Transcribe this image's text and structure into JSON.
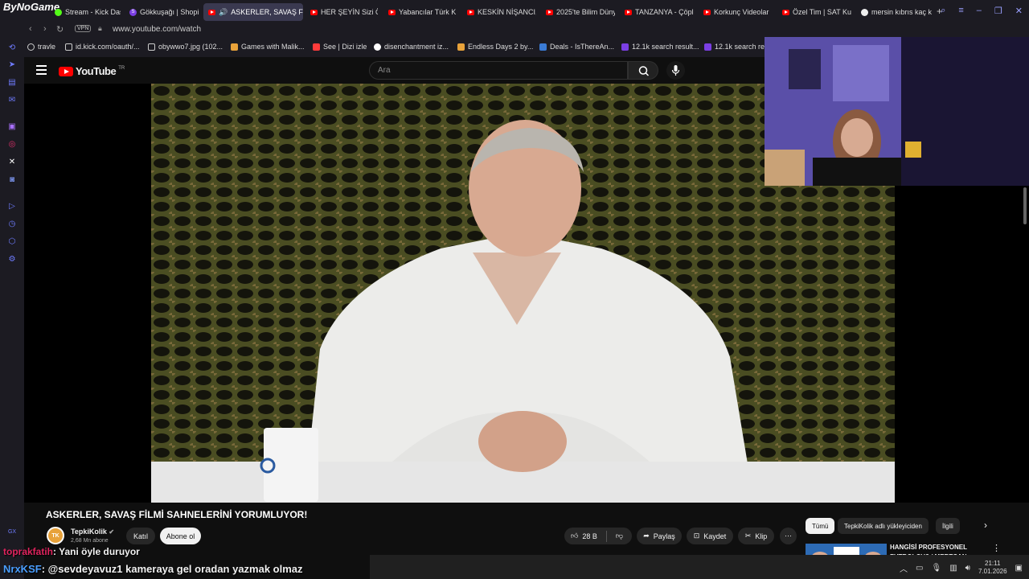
{
  "browser": {
    "logo_text": "ByNoGame",
    "tabs": [
      {
        "label": "Stream - Kick Dash",
        "icon": "kick-icon"
      },
      {
        "label": "Gökkuşağı | Shopi",
        "icon": "shop-icon"
      },
      {
        "label": "ASKERLER, SAVAŞ Fİ",
        "icon": "youtube-icon"
      },
      {
        "label": "HER ŞEYİN Sizi Ö",
        "icon": "youtube-icon"
      },
      {
        "label": "Yabancılar Türk K",
        "icon": "youtube-icon"
      },
      {
        "label": "KESKİN NİŞANCI,",
        "icon": "youtube-icon"
      },
      {
        "label": "2025'te Bilim Düny",
        "icon": "youtube-icon"
      },
      {
        "label": "TANZANYA - Çöpl",
        "icon": "youtube-icon"
      },
      {
        "label": "Korkunç Videolar",
        "icon": "youtube-icon"
      },
      {
        "label": "Özel Tim | SAT Ku",
        "icon": "youtube-icon"
      },
      {
        "label": "mersin kıbrıs kaç k",
        "icon": "google-icon"
      }
    ],
    "new_tab": "+",
    "vpn": "VPN",
    "url": "www.youtube.com/watch",
    "ai_label": "AI",
    "bookmarks": [
      "travle",
      "id.kick.com/oauth/...",
      "obywwo7.jpg (102...",
      "Games with Malik...",
      "See | Dizi izle",
      "disenchantment iz...",
      "Endless Days 2 by...",
      "Deals - IsThereAn...",
      "12.1k search result...",
      "12.1k search res"
    ]
  },
  "youtube": {
    "logo": "YouTube",
    "country": "TR",
    "search_placeholder": "Ara",
    "video_title": "ASKERLER, SAVAŞ FİLMİ SAHNELERİNİ YORUMLUYOR!",
    "channel_name": "TepkiKolik",
    "channel_initials": "TK",
    "subscribers": "2,68 Mn abone",
    "join_label": "Katıl",
    "subscribe_label": "Abone ol",
    "likes": "28 B",
    "share_label": "Paylaş",
    "save_label": "Kaydet",
    "clip_label": "Klip",
    "chips": [
      "Tümü",
      "TepkiKolik adlı yükleyiciden",
      "İlgili"
    ],
    "rec_title": "HANGİSİ PROFESYONEL FUTBOLCU? / MERTCAN"
  },
  "chat": {
    "user1": "toprakfatih",
    "msg1": ": Yani öyle duruyor",
    "user2": "NrxKSF",
    "msg2": ": @sevdeyavuz1 kameraya gel oradan yazmak olmaz"
  },
  "taskbar": {
    "time": "21:11",
    "date": "7.01.2026"
  },
  "colors": {
    "accent": "#6f7cff",
    "youtube_red": "#ff0000",
    "chat_user1": "#e0245e",
    "chat_user2": "#4a9eff"
  }
}
